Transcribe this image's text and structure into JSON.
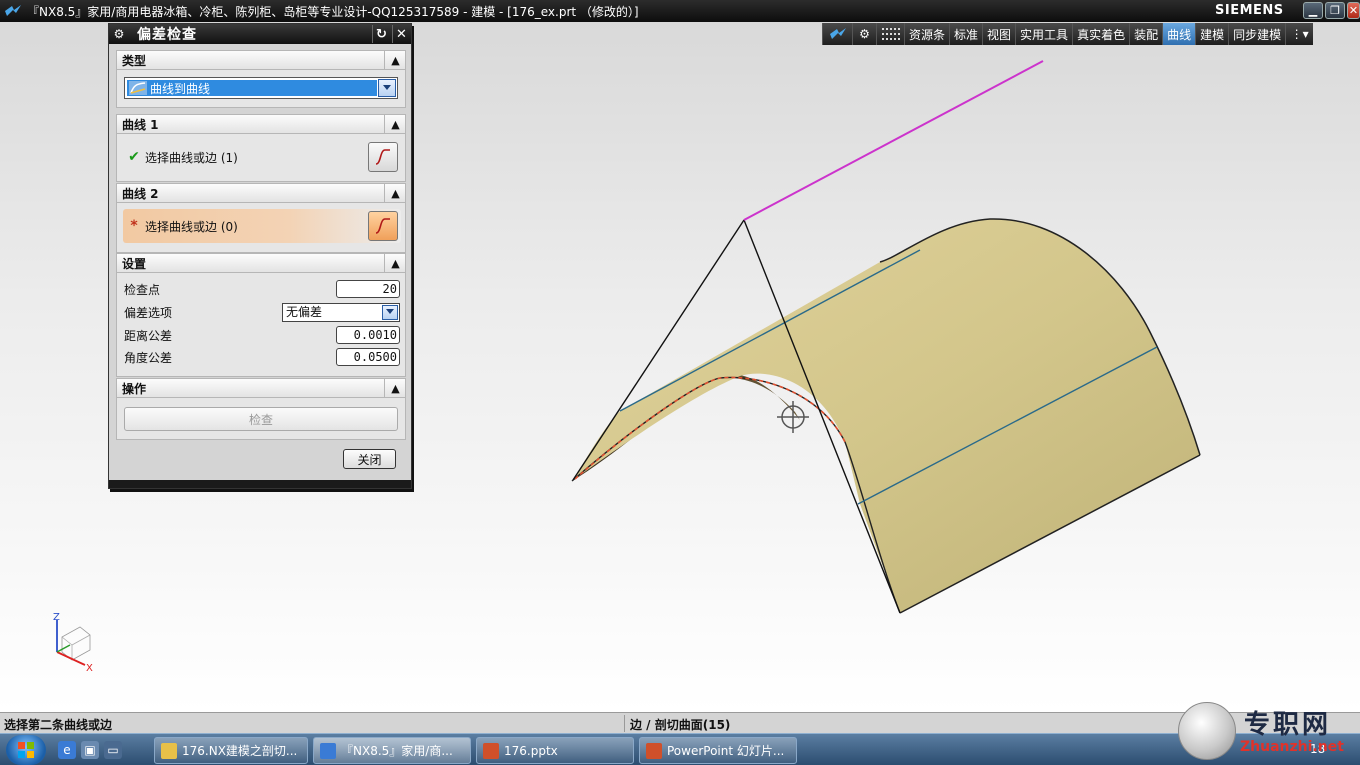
{
  "window": {
    "title": "『NX8.5』家用/商用电器冰箱、冷柜、陈列柜、岛柜等专业设计-QQ125317589 - 建模 - [176_ex.prt （修改的）]",
    "brand": "SIEMENS",
    "minimize_icon": "minimize-icon",
    "restore_icon": "restore-icon",
    "close_icon": "close-icon"
  },
  "toolbar": {
    "tabs": [
      "资源条",
      "标准",
      "视图",
      "实用工具",
      "真实着色",
      "装配",
      "曲线",
      "建模",
      "同步建模"
    ],
    "active_tab": "曲线"
  },
  "dialog": {
    "title": "偏差检查",
    "type_section": {
      "label": "类型",
      "selected": "曲线到曲线"
    },
    "curve1_section": {
      "label": "曲线 1",
      "select_text": "选择曲线或边 (1)"
    },
    "curve2_section": {
      "label": "曲线 2",
      "select_text": "选择曲线或边 (0)"
    },
    "settings_section": {
      "label": "设置",
      "check_points_label": "检查点",
      "check_points_value": "20",
      "deviation_option_label": "偏差选项",
      "deviation_option_value": "无偏差",
      "distance_tol_label": "距离公差",
      "distance_tol_value": "0.0010",
      "angle_tol_label": "角度公差",
      "angle_tol_value": "0.0500"
    },
    "operation_section": {
      "label": "操作",
      "check_button": "检查"
    },
    "close_button": "关闭"
  },
  "triad": {
    "z_label": "Z",
    "x_label": "X"
  },
  "statusbar": {
    "prompt": "选择第二条曲线或边",
    "status": "边 / 剖切曲面(15)"
  },
  "taskbar": {
    "tasks": [
      {
        "label": "176.NX建模之剖切...",
        "color": "#e8c048"
      },
      {
        "label": "『NX8.5』家用/商...",
        "color": "#3a7bd5"
      },
      {
        "label": "176.pptx",
        "color": "#d0502a"
      },
      {
        "label": "PowerPoint 幻灯片...",
        "color": "#d0502a"
      }
    ],
    "clock": "18"
  },
  "watermark": {
    "cn": "专职网",
    "en": "Zhuanzhi.net"
  },
  "colors": {
    "surface": "#cfc48a",
    "magenta_line": "#cc33cc",
    "blue_line": "#2a6a8a",
    "accent_blue": "#2f8be0"
  }
}
